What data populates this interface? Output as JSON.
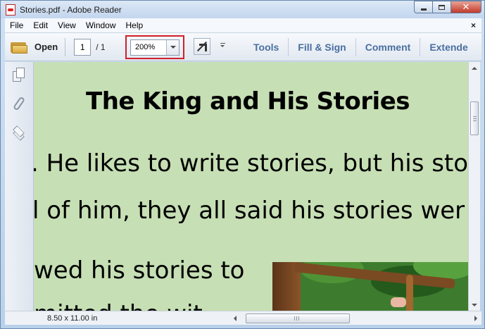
{
  "window": {
    "title": "Stories.pdf - Adobe Reader",
    "minimize_icon": "minimize-icon",
    "maximize_icon": "maximize-icon",
    "close_glyph": "✕"
  },
  "menubar": {
    "items": [
      {
        "label": "File"
      },
      {
        "label": "Edit"
      },
      {
        "label": "View"
      },
      {
        "label": "Window"
      },
      {
        "label": "Help"
      }
    ],
    "close_glyph": "×"
  },
  "toolbar": {
    "open_label": "Open",
    "page_current": "1",
    "page_total": "/ 1",
    "zoom_value": "200%",
    "links": [
      {
        "label": "Tools"
      },
      {
        "label": "Fill & Sign"
      },
      {
        "label": "Comment"
      },
      {
        "label": "Extende"
      }
    ]
  },
  "navpane": {
    "icons": [
      "pages-icon",
      "attachments-icon",
      "layers-icon"
    ]
  },
  "document": {
    "title": "The King and His Stories",
    "lines": [
      ". He likes to write stories, but his sto",
      "l of him, they all said his stories wer",
      "wed his stories to",
      "mitted the wit"
    ],
    "background_color": "#c6dfb4"
  },
  "status": {
    "page_size": "8.50 x 11.00 in"
  },
  "colors": {
    "toolbar_link": "#4a6fa0",
    "zoom_highlight": "#d0202a"
  }
}
